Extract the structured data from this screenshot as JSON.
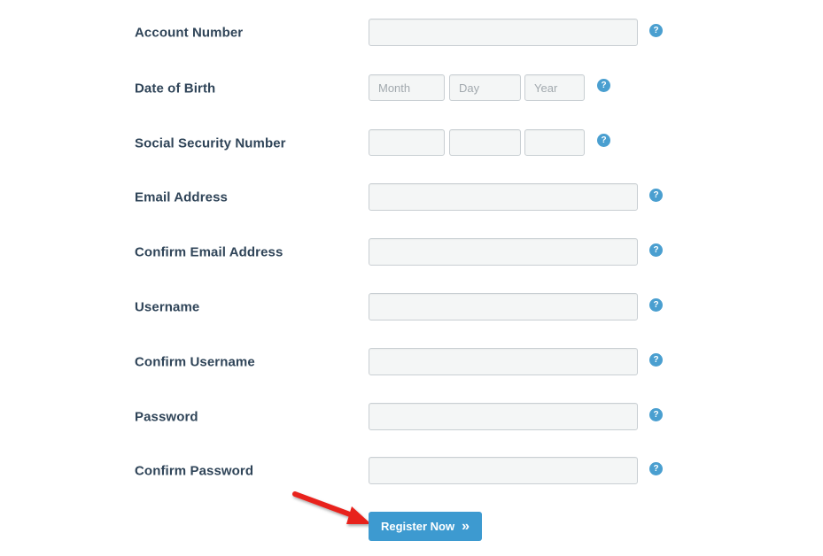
{
  "form": {
    "fields": [
      {
        "key": "account_number",
        "label": "Account Number",
        "value": ""
      },
      {
        "key": "dob",
        "label": "Date of Birth",
        "month_placeholder": "Month",
        "day_placeholder": "Day",
        "year_placeholder": "Year"
      },
      {
        "key": "ssn",
        "label": "Social Security Number",
        "part1": "",
        "part2": "",
        "part3": ""
      },
      {
        "key": "email",
        "label": "Email Address",
        "value": ""
      },
      {
        "key": "confirm_email",
        "label": "Confirm Email Address",
        "value": ""
      },
      {
        "key": "username",
        "label": "Username",
        "value": ""
      },
      {
        "key": "confirm_username",
        "label": "Confirm Username",
        "value": ""
      },
      {
        "key": "password",
        "label": "Password",
        "value": ""
      },
      {
        "key": "confirm_password",
        "label": "Confirm Password",
        "value": ""
      }
    ],
    "help_glyph": "?",
    "register_label": "Register Now",
    "register_icon": "»"
  },
  "colors": {
    "label": "#2f4458",
    "help_icon": "#4a9fd0",
    "button": "#3d9ad0",
    "annotation_arrow": "#e8241f"
  },
  "icons": {
    "help": "question-circle-icon",
    "button": "double-chevron-right-icon",
    "annotation": "red-arrow-icon"
  }
}
